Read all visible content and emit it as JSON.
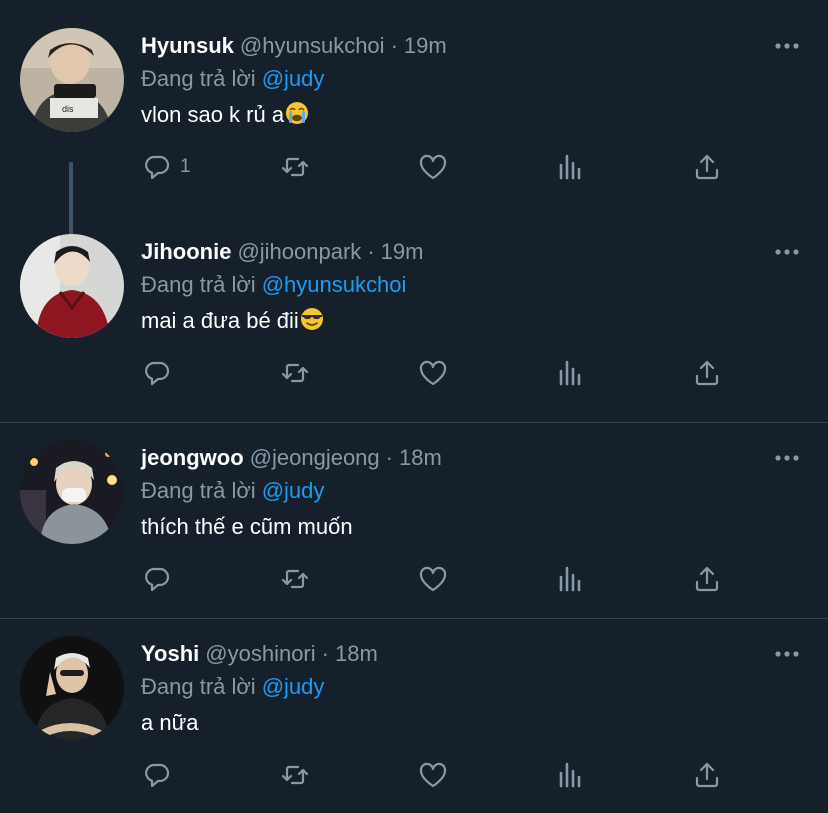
{
  "tweets": [
    {
      "name": "Hyunsuk",
      "handle": "@hyunsukchoi",
      "time": "19m",
      "reply_prefix": "Đang trả lời",
      "reply_to": "@judy",
      "text": "vlon sao k rủ a",
      "emoji": "loudly-crying-face",
      "reply_count": "1"
    },
    {
      "name": "Jihoonie",
      "handle": "@jihoonpark",
      "time": "19m",
      "reply_prefix": "Đang trả lời",
      "reply_to": "@hyunsukchoi",
      "text": "mai a đưa bé đii",
      "emoji": "smiling-face-with-sunglasses",
      "reply_count": ""
    },
    {
      "name": "jeongwoo",
      "handle": "@jeongjeong",
      "time": "18m",
      "reply_prefix": "Đang trả lời",
      "reply_to": "@judy",
      "text": "thích thế e cũm muốn",
      "reply_count": ""
    },
    {
      "name": "Yoshi",
      "handle": "@yoshinori",
      "time": "18m",
      "reply_prefix": "Đang trả lời",
      "reply_to": "@judy",
      "text": "a nữa",
      "reply_count": ""
    }
  ],
  "separator": "·",
  "icons": {
    "more": "more-horizontal-icon",
    "reply": "reply-icon",
    "retweet": "retweet-icon",
    "like": "heart-icon",
    "analytics": "analytics-icon",
    "share": "share-icon"
  },
  "colors": {
    "background": "#15202b",
    "link": "#1d9bf0",
    "secondary_text": "#8899a6",
    "divider": "#38444d",
    "thread_line": "#3d5466"
  }
}
